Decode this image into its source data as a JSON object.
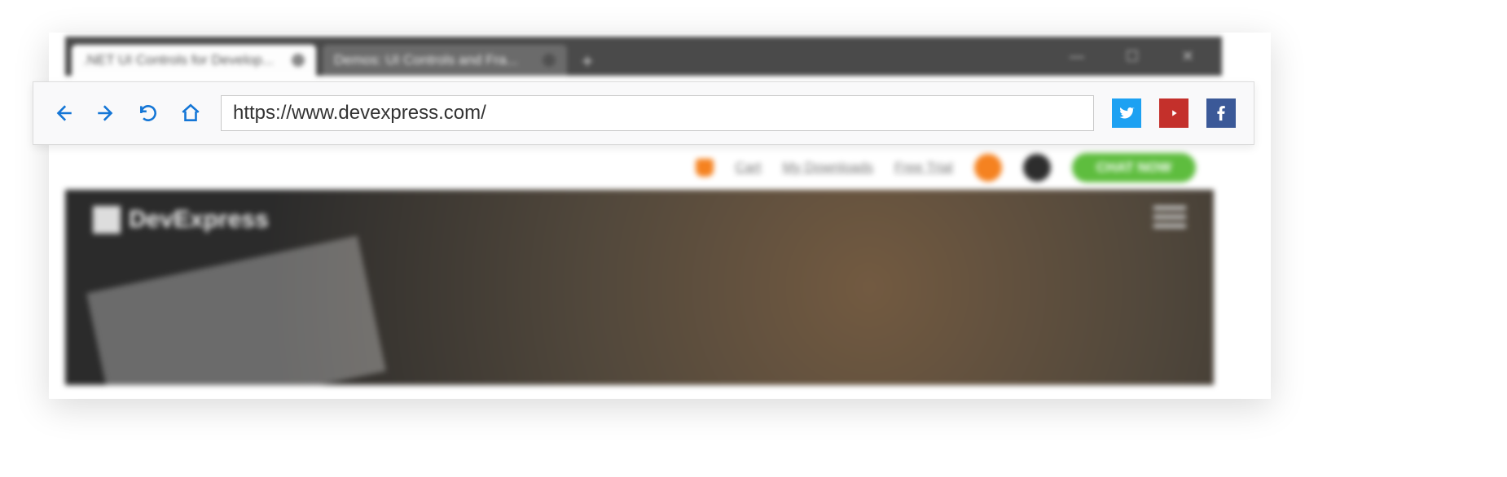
{
  "tabs": [
    {
      "title": ".NET UI Controls for Develop...",
      "active": true
    },
    {
      "title": "Demos: UI Controls and Fra...",
      "active": false
    }
  ],
  "toolbar": {
    "url": "https://www.devexpress.com/",
    "icons": {
      "back": "back-icon",
      "forward": "forward-icon",
      "reload": "reload-icon",
      "home": "home-icon",
      "twitter": "twitter-icon",
      "youtube": "youtube-icon",
      "facebook": "facebook-icon"
    }
  },
  "page": {
    "top_links": {
      "cart": "Cart",
      "downloads": "My Downloads",
      "trial": "Free Trial",
      "chat": "CHAT NOW"
    },
    "brand": "DevExpress"
  }
}
